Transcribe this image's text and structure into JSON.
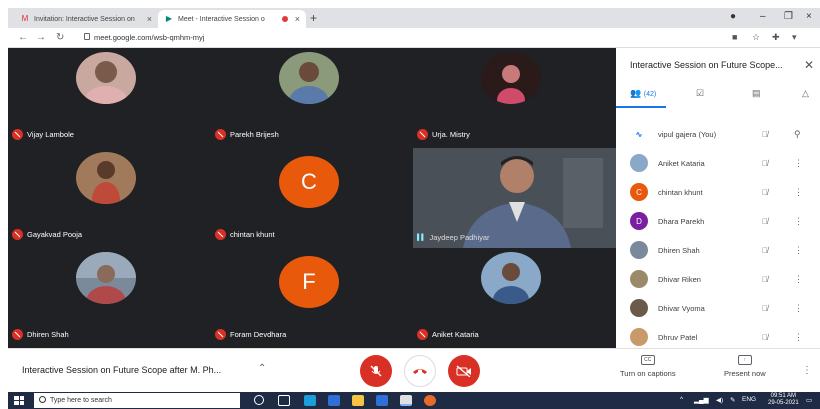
{
  "browser": {
    "tabs": [
      {
        "label": "Invitation: Interactive Session on",
        "icon": "gmail-icon"
      },
      {
        "label": "Meet - Interactive Session o",
        "icon": "meet-icon",
        "active": true,
        "recording": true
      }
    ],
    "url": "meet.google.com/wsb-qmhm-myj"
  },
  "grid": {
    "tiles": [
      {
        "name": "Vijay Lambole",
        "type": "photo",
        "color": "#c9a8a0"
      },
      {
        "name": "Parekh Brijesh",
        "type": "photo",
        "color": "#8a9a7a"
      },
      {
        "name": "Urja. Mistry",
        "type": "photo",
        "color": "#2a1a1a"
      },
      {
        "name": "Gayakvad Pooja",
        "type": "photo",
        "color": "#a07a5a"
      },
      {
        "name": "chintan khunt",
        "type": "letter",
        "letter": "C",
        "color": "#e8590c"
      },
      {
        "name": "Gayakvad Pooja",
        "type": "hidden"
      },
      {
        "name": "Dhiren Shah",
        "type": "photo",
        "color": "#7a8a9a"
      },
      {
        "name": "Foram Devdhara",
        "type": "letter",
        "letter": "F",
        "color": "#e8590c"
      },
      {
        "name": "Aniket Kataria",
        "type": "photo",
        "color": "#8aa8c8"
      }
    ],
    "live_speaker": "Jaydeep Padhiyar"
  },
  "panel": {
    "title": "Interactive Session on Future Scope...",
    "people_count": "(42)",
    "participants": [
      {
        "name": "vipul gajera (You)",
        "avatar": "logo",
        "color": "#1a73e8",
        "pin": true
      },
      {
        "name": "Aniket Kataria",
        "avatar": "photo",
        "color": "#8aa8c8"
      },
      {
        "name": "chintan khunt",
        "avatar": "C",
        "color": "#e8590c"
      },
      {
        "name": "Dhara Parekh",
        "avatar": "D",
        "color": "#7b1fa2"
      },
      {
        "name": "Dhiren Shah",
        "avatar": "photo",
        "color": "#7a8a9a"
      },
      {
        "name": "Dhivar Riken",
        "avatar": "photo",
        "color": "#9a8a6a"
      },
      {
        "name": "Dhivar Vyoma",
        "avatar": "photo",
        "color": "#6a5a4a"
      },
      {
        "name": "Dhruv Patel",
        "avatar": "photo",
        "color": "#c89a6a"
      }
    ]
  },
  "bottom": {
    "meeting_title": "Interactive Session on Future Scope after M. Ph...",
    "captions_label": "Turn on captions",
    "present_label": "Present now"
  },
  "taskbar": {
    "search_placeholder": "Type here to search",
    "language": "ENG",
    "time": "09:51 AM",
    "date": "29-05-2021"
  },
  "colors": {
    "accent": "#1a73e8",
    "danger": "#d93025",
    "stage": "#202124"
  }
}
